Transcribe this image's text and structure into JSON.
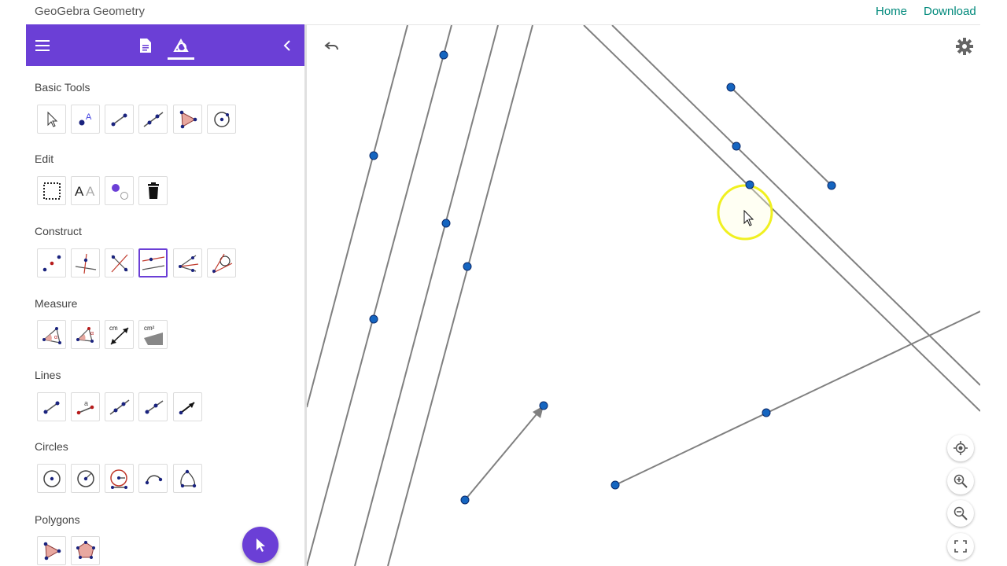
{
  "topbar": {
    "app_title": "GeoGebra Geometry",
    "home_link": "Home",
    "download_link": "Download"
  },
  "panel": {
    "header_icons": [
      "menu-icon",
      "algebra-view-icon",
      "tools-icon",
      "collapse-panel-icon"
    ],
    "sections": [
      {
        "title": "Basic Tools",
        "tools": [
          "move-tool",
          "point-tool",
          "segment-tool",
          "line-tool",
          "polygon-tool",
          "circle-center-point-tool"
        ]
      },
      {
        "title": "Edit",
        "tools": [
          "select-objects-tool",
          "show-hide-label-tool",
          "show-hide-object-tool",
          "delete-tool"
        ]
      },
      {
        "title": "Construct",
        "tools": [
          "midpoint-tool",
          "perpendicular-line-tool",
          "perpendicular-bisector-tool",
          "parallel-line-tool",
          "angle-bisector-tool",
          "tangents-tool"
        ],
        "selected_tool": "parallel-line-tool"
      },
      {
        "title": "Measure",
        "tools": [
          "angle-tool",
          "angle-given-size-tool",
          "distance-length-tool",
          "area-tool"
        ],
        "labels": {
          "distance": "cm",
          "area": "cm²"
        }
      },
      {
        "title": "Lines",
        "tools": [
          "segment-tool",
          "segment-given-length-tool",
          "line-tool",
          "ray-tool",
          "vector-tool"
        ],
        "labels": {
          "segment_given_length": "a"
        }
      },
      {
        "title": "Circles",
        "tools": [
          "circle-center-point-tool",
          "circle-center-radius-tool",
          "compass-tool",
          "semicircle-tool",
          "circle-three-points-tool"
        ]
      },
      {
        "title": "Polygons",
        "tools": [
          "polygon-tool",
          "regular-polygon-tool"
        ]
      }
    ]
  },
  "canvas": {
    "buttons": [
      "undo-icon",
      "settings-gear-icon",
      "standard-view-icon",
      "zoom-in-icon",
      "zoom-out-icon",
      "fullscreen-icon"
    ]
  },
  "colors": {
    "accent": "#6b3fd6",
    "link": "#00897b",
    "point": "#1565c0",
    "line": "#808080",
    "cursor_highlight": "#f0f020"
  }
}
